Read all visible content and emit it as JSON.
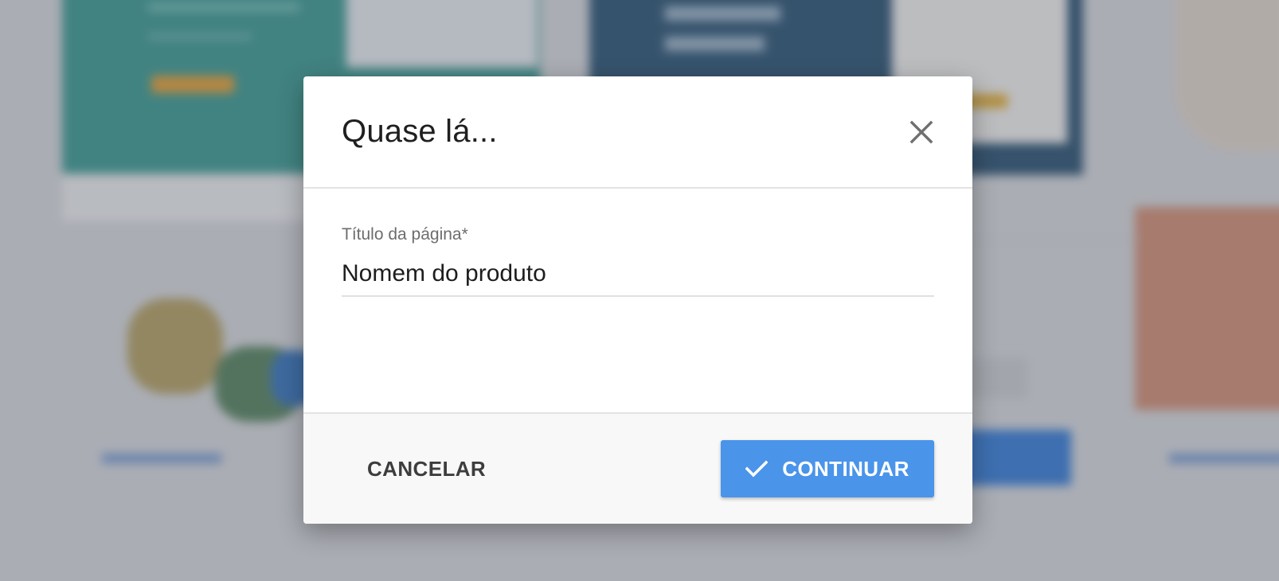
{
  "modal": {
    "title": "Quase lá...",
    "close_icon": "close-icon",
    "field": {
      "label": "Título da página*",
      "value": "Nomem do produto"
    },
    "cancel_label": "CANCELAR",
    "continue_label": "CONTINUAR",
    "continue_icon": "check-icon"
  },
  "colors": {
    "primary": "#4a94ea",
    "title_text": "#1f1f1f",
    "label_text": "#6d6d6d",
    "footer_bg": "#f8f8f8"
  }
}
